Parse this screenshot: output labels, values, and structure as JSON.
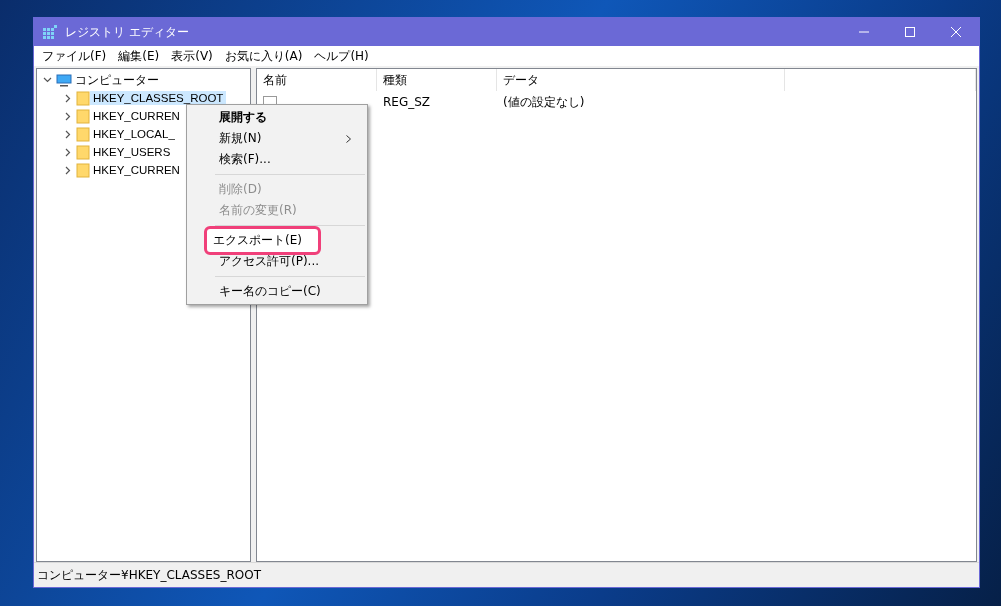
{
  "window": {
    "title": "レジストリ エディター"
  },
  "menu_bar": [
    "ファイル(F)",
    "編集(E)",
    "表示(V)",
    "お気に入り(A)",
    "ヘルプ(H)"
  ],
  "tree": {
    "label": "コンピューター",
    "expanded": true,
    "children": [
      {
        "label": "HKEY_CLASSES_ROOT",
        "selected": true
      },
      {
        "label": "HKEY_CURREN",
        "selected": false
      },
      {
        "label": "HKEY_LOCAL_",
        "selected": false
      },
      {
        "label": "HKEY_USERS",
        "selected": false
      },
      {
        "label": "HKEY_CURREN",
        "selected": false
      }
    ]
  },
  "table": {
    "columns": [
      "名前",
      "種類",
      "データ"
    ],
    "rows": [
      {
        "type": "REG_SZ",
        "data": "(値の設定なし)"
      }
    ]
  },
  "context_menu": [
    {
      "kind": "item",
      "label": "展開する",
      "bold": true,
      "disabled": false,
      "highlighted": false
    },
    {
      "kind": "submenu",
      "label": "新規(N)",
      "bold": false,
      "disabled": false,
      "highlighted": false
    },
    {
      "kind": "item",
      "label": "検索(F)...",
      "bold": false,
      "disabled": false,
      "highlighted": false
    },
    {
      "kind": "separator"
    },
    {
      "kind": "item",
      "label": "削除(D)",
      "bold": false,
      "disabled": true,
      "highlighted": false
    },
    {
      "kind": "item",
      "label": "名前の変更(R)",
      "bold": false,
      "disabled": true,
      "highlighted": false
    },
    {
      "kind": "separator"
    },
    {
      "kind": "item",
      "label": "エクスポート(E)",
      "bold": false,
      "disabled": false,
      "highlighted": true
    },
    {
      "kind": "item",
      "label": "アクセス許可(P)...",
      "bold": false,
      "disabled": false,
      "highlighted": false
    },
    {
      "kind": "separator"
    },
    {
      "kind": "item",
      "label": "キー名のコピー(C)",
      "bold": false,
      "disabled": false,
      "highlighted": false
    }
  ],
  "status_bar": "コンピューター¥HKEY_CLASSES_ROOT"
}
